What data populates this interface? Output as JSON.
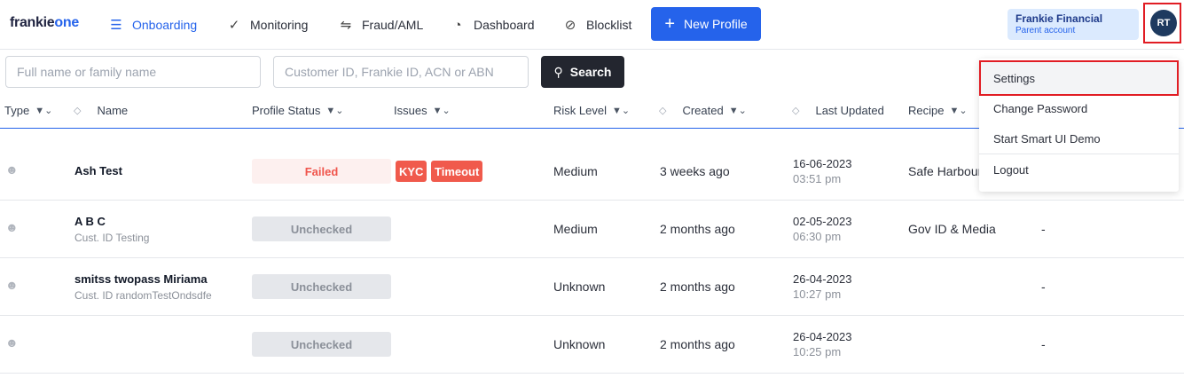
{
  "nav": {
    "logo_main": "frankie",
    "logo_accent": "one",
    "items": [
      {
        "label": "Onboarding",
        "icon": "list-icon"
      },
      {
        "label": "Monitoring",
        "icon": "check-icon"
      },
      {
        "label": "Fraud/AML",
        "icon": "swap-icon"
      },
      {
        "label": "Dashboard",
        "icon": "pie-chart-icon"
      },
      {
        "label": "Blocklist",
        "icon": "block-icon"
      }
    ],
    "new_profile_label": "New Profile",
    "account_name": "Frankie Financial",
    "account_sub": "Parent account",
    "avatar_initials": "RT"
  },
  "search": {
    "name_placeholder": "Full name or family name",
    "id_placeholder": "Customer ID, Frankie ID, ACN or ABN",
    "button_label": "Search"
  },
  "table": {
    "headers": {
      "type": "Type",
      "name": "Name",
      "profile_status": "Profile Status",
      "issues": "Issues",
      "risk_level": "Risk Level",
      "created": "Created",
      "last_updated": "Last Updated",
      "recipe": "Recipe"
    },
    "rows": [
      {
        "name": "Ash Test",
        "sub": "",
        "status": "Failed",
        "issues": [
          "KYC",
          "Timeout"
        ],
        "risk": "Medium",
        "created": "3 weeks ago",
        "updated_date": "16-06-2023",
        "updated_time": "03:51 pm",
        "recipe": "Safe Harbour",
        "extra": ""
      },
      {
        "name": "A B C",
        "sub": "Cust. ID Testing",
        "status": "Unchecked",
        "issues": [],
        "risk": "Medium",
        "created": "2 months ago",
        "updated_date": "02-05-2023",
        "updated_time": "06:30 pm",
        "recipe": "Gov ID & Media",
        "extra": "-"
      },
      {
        "name": "smitss twopass Miriama",
        "sub": "Cust. ID randomTestOndsdfe",
        "status": "Unchecked",
        "issues": [],
        "risk": "Unknown",
        "created": "2 months ago",
        "updated_date": "26-04-2023",
        "updated_time": "10:27 pm",
        "recipe": "",
        "extra": "-"
      },
      {
        "name": "",
        "sub": "",
        "status": "Unchecked",
        "issues": [],
        "risk": "Unknown",
        "created": "2 months ago",
        "updated_date": "26-04-2023",
        "updated_time": "10:25 pm",
        "recipe": "",
        "extra": "-"
      }
    ]
  },
  "dropdown": {
    "items": [
      "Settings",
      "Change Password",
      "Start Smart UI Demo",
      "Logout"
    ]
  },
  "colors": {
    "primary": "#2563eb",
    "highlight_border": "#e11d24",
    "failed": "#f05a4c"
  }
}
